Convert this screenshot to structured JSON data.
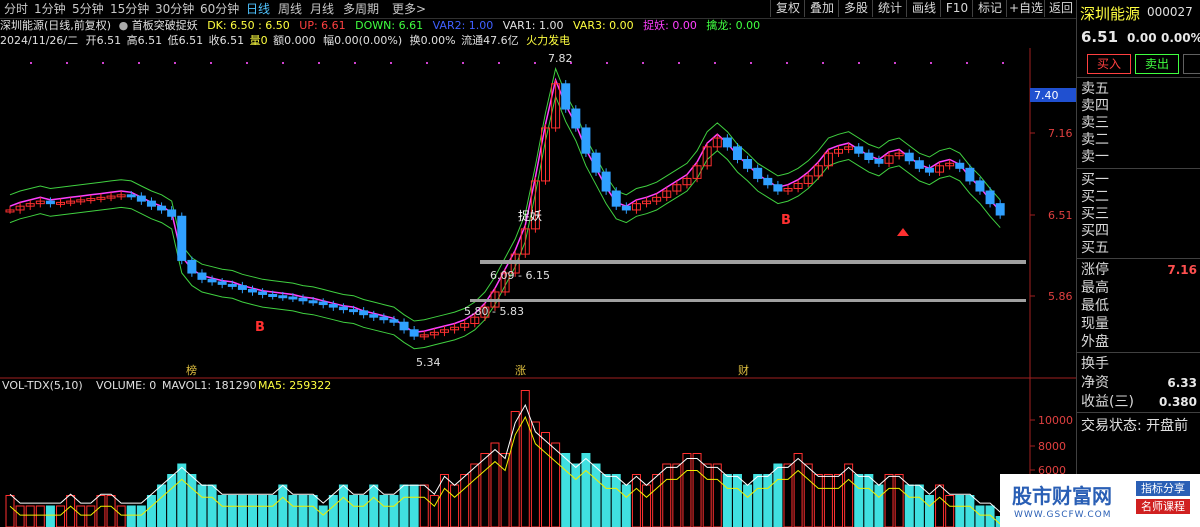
{
  "toolbar": {
    "periods": [
      "分时",
      "1分钟",
      "5分钟",
      "15分钟",
      "30分钟",
      "60分钟",
      "日线",
      "周线",
      "月线",
      "多周期",
      "更多>"
    ],
    "active_period": "日线",
    "buttons": [
      "复权",
      "叠加",
      "多股",
      "统计",
      "画线",
      "F10",
      "标记",
      "+自选",
      "返回"
    ]
  },
  "info": {
    "stock_title": "深圳能源(日线,前复权)",
    "indicator_name": "首板突破捉妖",
    "dk": "DK: 6.50 : 6.50",
    "up": "UP: 6.61",
    "down": "DOWN: 6.61",
    "var2": "VAR2: 1.00",
    "var1": "VAR1: 1.00",
    "var3": "VAR3: 0.00",
    "zhuoyao": "捉妖: 0.00",
    "qinlong": "擒龙: 0.00"
  },
  "ohlc": {
    "date": "2024/11/26/二",
    "open": "开6.51",
    "high": "高6.51",
    "low": "低6.51",
    "close": "收6.51",
    "volume": "量0",
    "amount": "额0.000",
    "range": "幅0.00(0.00%)",
    "turnover": "换0.00%",
    "float": "流通47.6亿",
    "signal": "火力发电"
  },
  "price_axis": {
    "labels": [
      "7.16",
      "6.51",
      "5.86"
    ],
    "current_box": "7.40"
  },
  "annotations": {
    "high_label": "7.82",
    "low_label": "5.34",
    "zone1": "6.09 - 6.15",
    "zone2": "5.80 - 5.83",
    "zhuoyao_label": "捉妖",
    "b_label": "B",
    "event_bang": "榜",
    "event_zhang": "涨",
    "event_cai": "财"
  },
  "volume_panel": {
    "title": "VOL-TDX(5,10)",
    "volume": "VOLUME: 0",
    "mavol1": "MAVOL1: 181290",
    "ma5": "MA5: 259322",
    "axis_labels": [
      "10000",
      "8000",
      "6000"
    ],
    "unit_colors": {
      "up": "#ff3030",
      "down": "#40e0e0",
      "ma1": "#ffffff",
      "ma2": "#f0f000"
    }
  },
  "sidebar": {
    "name": "深圳能源",
    "code": "000027",
    "price": "6.51",
    "change": "0.00",
    "change_pct": "0.00%",
    "buy_button": "买入",
    "sell_button": "卖出",
    "sell_levels": [
      "卖五",
      "卖四",
      "卖三",
      "卖二",
      "卖一"
    ],
    "buy_levels": [
      "买一",
      "买二",
      "买三",
      "买四",
      "买五"
    ],
    "stats": [
      {
        "label": "涨停",
        "value": "7.16"
      },
      {
        "label": "最高",
        "value": ""
      },
      {
        "label": "最低",
        "value": ""
      },
      {
        "label": "现量",
        "value": ""
      },
      {
        "label": "外盘",
        "value": ""
      }
    ],
    "stats2": [
      {
        "label": "换手",
        "value": ""
      },
      {
        "label": "净资",
        "value": "6.33"
      },
      {
        "label": "收益(三)",
        "value": "0.380"
      }
    ],
    "trade_status": "交易状态: 开盘前"
  },
  "watermark": {
    "brand": "股市财富网",
    "tag1": "指标分享",
    "tag2": "名师课程",
    "url": "WWW.GSCFW.COM"
  }
}
